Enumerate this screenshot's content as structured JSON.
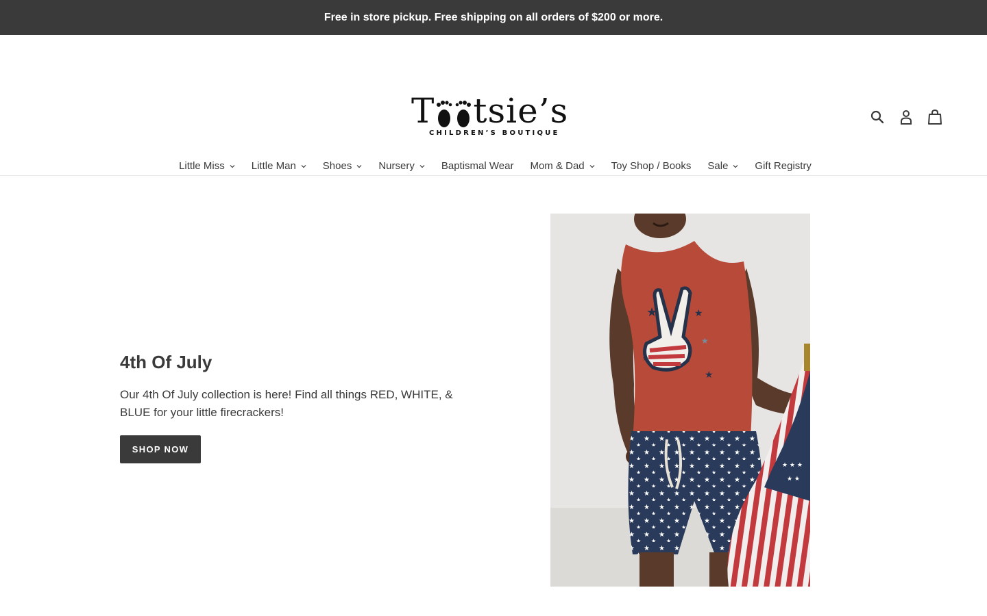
{
  "announcement": {
    "text": "Free in store pickup. Free shipping on all orders of $200 or more."
  },
  "brand": {
    "name_start": "T",
    "name_end": "tsie’s",
    "tagline": "CHILDREN’S BOUTIQUE"
  },
  "header_icons": [
    {
      "icon": "search-icon"
    },
    {
      "icon": "account-icon"
    },
    {
      "icon": "cart-icon"
    }
  ],
  "nav": {
    "items": [
      {
        "label": "Little Miss",
        "has_dropdown": true
      },
      {
        "label": "Little Man",
        "has_dropdown": true
      },
      {
        "label": "Shoes",
        "has_dropdown": true
      },
      {
        "label": "Nursery",
        "has_dropdown": true
      },
      {
        "label": "Baptismal Wear",
        "has_dropdown": false
      },
      {
        "label": "Mom & Dad",
        "has_dropdown": true
      },
      {
        "label": "Toy Shop / Books",
        "has_dropdown": false
      },
      {
        "label": "Sale",
        "has_dropdown": true
      },
      {
        "label": "Gift Registry",
        "has_dropdown": false
      }
    ]
  },
  "hero": {
    "title": "4th Of July",
    "description": "Our 4th Of July collection is here! Find all things RED, WHITE, & BLUE for your little firecrackers!",
    "button_label": "SHOP NOW"
  },
  "colors": {
    "announcement_bg": "#3a3a3a",
    "button_bg": "#3a3a3a",
    "text": "#3a3a3a",
    "tank_red": "#b84a3a",
    "shorts_navy": "#2a3a5a"
  }
}
